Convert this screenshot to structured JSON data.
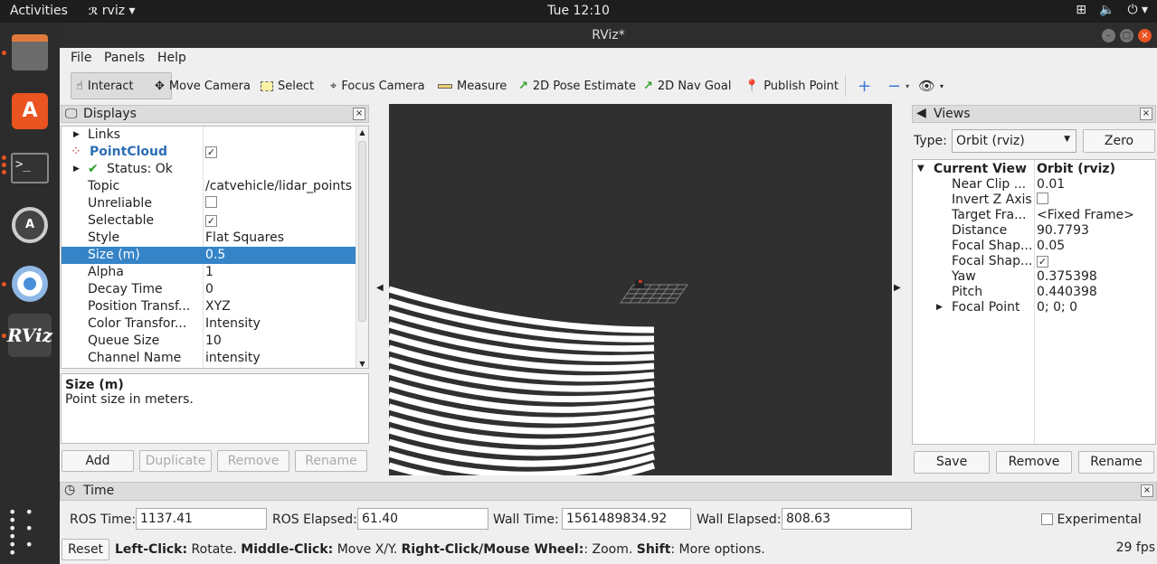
{
  "topbar": {
    "activities": "Activities",
    "app_name": "rviz",
    "clock": "Tue 12:10"
  },
  "window": {
    "title": "RViz*"
  },
  "menu": {
    "file": "File",
    "panels": "Panels",
    "help": "Help"
  },
  "toolbar": {
    "interact": "Interact",
    "move_camera": "Move Camera",
    "select": "Select",
    "focus_camera": "Focus Camera",
    "measure": "Measure",
    "pose_estimate": "2D Pose Estimate",
    "nav_goal": "2D Nav Goal",
    "publish_point": "Publish Point"
  },
  "displays": {
    "title": "Displays",
    "rows": [
      {
        "label": "Links",
        "value": ""
      },
      {
        "label": "PointCloud",
        "value": ""
      },
      {
        "label": "Status: Ok",
        "value": ""
      },
      {
        "label": "Topic",
        "value": "/catvehicle/lidar_points"
      },
      {
        "label": "Unreliable",
        "value": ""
      },
      {
        "label": "Selectable",
        "value": ""
      },
      {
        "label": "Style",
        "value": "Flat Squares"
      },
      {
        "label": "Size (m)",
        "value": "0.5"
      },
      {
        "label": "Alpha",
        "value": "1"
      },
      {
        "label": "Decay Time",
        "value": "0"
      },
      {
        "label": "Position Transf...",
        "value": "XYZ"
      },
      {
        "label": "Color Transfor...",
        "value": "Intensity"
      },
      {
        "label": "Queue Size",
        "value": "10"
      },
      {
        "label": "Channel Name",
        "value": "intensity"
      }
    ],
    "desc_title": "Size (m)",
    "desc_text": "Point size in meters.",
    "add": "Add",
    "duplicate": "Duplicate",
    "remove": "Remove",
    "rename": "Rename"
  },
  "views": {
    "title": "Views",
    "type_label": "Type:",
    "type_value": "Orbit (rviz)",
    "zero": "Zero",
    "rows": [
      {
        "label": "Current View",
        "value": "Orbit (rviz)"
      },
      {
        "label": "Near Clip ...",
        "value": "0.01"
      },
      {
        "label": "Invert Z Axis",
        "value": ""
      },
      {
        "label": "Target Fra...",
        "value": "<Fixed Frame>"
      },
      {
        "label": "Distance",
        "value": "90.7793"
      },
      {
        "label": "Focal Shap...",
        "value": "0.05"
      },
      {
        "label": "Focal Shap...",
        "value": ""
      },
      {
        "label": "Yaw",
        "value": "0.375398"
      },
      {
        "label": "Pitch",
        "value": "0.440398"
      },
      {
        "label": "Focal Point",
        "value": "0; 0; 0"
      }
    ],
    "save": "Save",
    "remove": "Remove",
    "rename": "Rename"
  },
  "time": {
    "title": "Time",
    "ros_time_label": "ROS Time:",
    "ros_time": "1137.41",
    "ros_elapsed_label": "ROS Elapsed:",
    "ros_elapsed": "61.40",
    "wall_time_label": "Wall Time:",
    "wall_time": "1561489834.92",
    "wall_elapsed_label": "Wall Elapsed:",
    "wall_elapsed": "808.63",
    "experimental": "Experimental"
  },
  "status": {
    "reset": "Reset",
    "h1": "Left-Click:",
    "t1": " Rotate. ",
    "h2": "Middle-Click:",
    "t2": " Move X/Y. ",
    "h3": "Right-Click/Mouse Wheel:",
    "t3": ": Zoom. ",
    "h4": "Shift",
    "t4": ": More options.",
    "fps": "29 fps"
  }
}
